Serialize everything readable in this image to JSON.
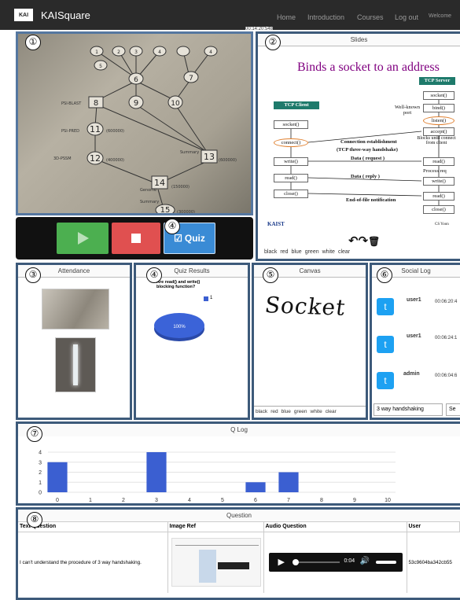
{
  "navbar": {
    "logo": "KAI",
    "brand": "KAISquare",
    "links": [
      "Home",
      "Introduction",
      "Courses",
      "Log out",
      "Welcome"
    ],
    "timestamp": "00:14:20:548"
  },
  "controls": {
    "quiz_label": "Quiz"
  },
  "slides": {
    "panel_title": "Slides",
    "title": "Binds a socket to an address",
    "client_label": "TCP Client",
    "server_label": "TCP Server",
    "client_calls": [
      "socket()",
      "connect()",
      "write()",
      "read()",
      "close()"
    ],
    "server_calls": [
      "socket()",
      "bind()",
      "listen()",
      "accept()",
      "read()",
      "write()",
      "read()",
      "close()"
    ],
    "notes": [
      "Well-known port",
      "Blocks until connect from client",
      "Connection establishment",
      "(TCP three-way handshake)",
      "Data ( request )",
      "Process req",
      "Data ( reply )",
      "End-of-file notification"
    ],
    "footer_logo": "KAIST",
    "footer_right": "CS Yoon",
    "colors": [
      "black",
      "red",
      "blue",
      "green",
      "white",
      "clear"
    ]
  },
  "attendance": {
    "panel_title": "Attendance"
  },
  "quiz_results": {
    "panel_title": "Quiz Results",
    "question": "Are read() and write() blocking function?",
    "legend": "1",
    "pie_label": "100%"
  },
  "canvas": {
    "panel_title": "Canvas",
    "drawing_text": "Socket",
    "colors": [
      "black",
      "red",
      "blue",
      "green",
      "white",
      "clear"
    ]
  },
  "social_log": {
    "panel_title": "Social Log",
    "entries": [
      {
        "user": "user1",
        "time": "00:06:20:4"
      },
      {
        "user": "user1",
        "time": "00:06:24:1"
      },
      {
        "user": "admin",
        "time": "00:06:04:6"
      }
    ],
    "input_value": "3 way handshaking",
    "send_label": "Se"
  },
  "q_log": {
    "panel_title": "Q Log"
  },
  "chart_data": {
    "type": "bar",
    "x": [
      0,
      1,
      2,
      3,
      4,
      5,
      6,
      7,
      8,
      9,
      10
    ],
    "values": [
      3,
      0,
      0,
      4,
      0,
      0,
      1,
      2,
      0,
      0,
      0
    ],
    "ylim": [
      0,
      4
    ],
    "yticks": [
      0,
      1,
      2,
      3,
      4
    ],
    "xticks": [
      0,
      1,
      2,
      3,
      4,
      5,
      6,
      7,
      8,
      9,
      10
    ],
    "color": "#3b5fd1"
  },
  "question": {
    "panel_title": "Question",
    "columns": [
      "Text Question",
      "Image Ref",
      "Audio Question",
      "User"
    ],
    "row": {
      "text": "I can't understand the procedure of 3 way handshaking.",
      "audio_time": "0:04",
      "user": "53c9604ba342cb55"
    }
  },
  "panel_numbers": [
    "①",
    "②",
    "③",
    "④",
    "④",
    "⑤",
    "⑥",
    "⑦",
    "⑧"
  ]
}
